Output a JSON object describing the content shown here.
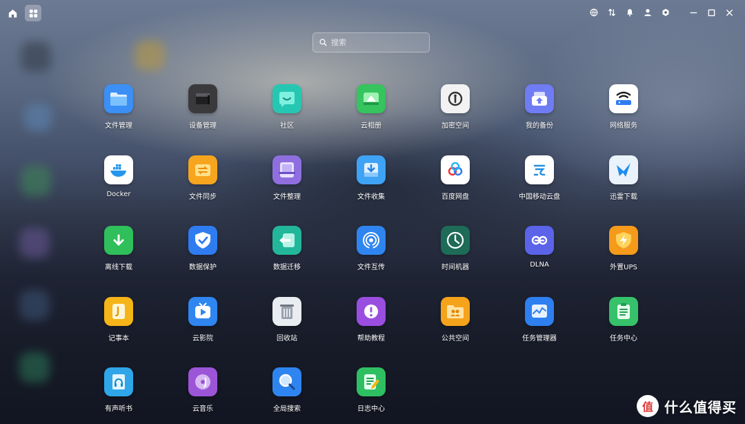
{
  "topbar": {
    "left": [
      {
        "name": "home",
        "icon": "home-icon",
        "active": false
      },
      {
        "name": "apps",
        "icon": "grid-icon",
        "active": true
      }
    ],
    "right": [
      {
        "name": "globe",
        "icon": "globe-icon"
      },
      {
        "name": "transfer",
        "icon": "transfer-icon"
      },
      {
        "name": "notification",
        "icon": "bell-icon"
      },
      {
        "name": "user",
        "icon": "user-icon"
      },
      {
        "name": "settings",
        "icon": "hexagon-settings-icon"
      },
      {
        "name": "minimize",
        "icon": "minimize-icon"
      },
      {
        "name": "maximize",
        "icon": "maximize-icon"
      },
      {
        "name": "close",
        "icon": "close-icon"
      }
    ]
  },
  "search": {
    "placeholder": "搜索"
  },
  "apps": [
    {
      "label": "文件管理",
      "icon": "folder-icon",
      "color": "#3b8ff5"
    },
    {
      "label": "设备管理",
      "icon": "device-box-icon",
      "color": "#3a3a3d"
    },
    {
      "label": "社区",
      "icon": "community-bubble-icon",
      "color": "#26c7b2"
    },
    {
      "label": "云相册",
      "icon": "photo-album-icon",
      "color": "#35c45e"
    },
    {
      "label": "加密空间",
      "icon": "safe-lock-icon",
      "color": "#f2f2f2"
    },
    {
      "label": "我的备份",
      "icon": "backup-upload-icon",
      "color": "#6f7cf3"
    },
    {
      "label": "网络服务",
      "icon": "wifi-router-icon",
      "color": "#ffffff"
    },
    {
      "label": "Docker",
      "icon": "docker-whale-icon",
      "color": "#ffffff"
    },
    {
      "label": "文件同步",
      "icon": "sync-folder-icon",
      "color": "#f7a51e"
    },
    {
      "label": "文件整理",
      "icon": "organize-drawer-icon",
      "color": "#8f6fe0"
    },
    {
      "label": "文件收集",
      "icon": "collect-download-icon",
      "color": "#3fa3f5"
    },
    {
      "label": "百度网盘",
      "icon": "baidu-pan-icon",
      "color": "#ffffff"
    },
    {
      "label": "中国移动云盘",
      "icon": "china-mobile-cloud-icon",
      "color": "#ffffff"
    },
    {
      "label": "迅雷下载",
      "icon": "thunder-bird-icon",
      "color": "#eaf3fc"
    },
    {
      "label": "离线下载",
      "icon": "offline-download-icon",
      "color": "#2fbf5b"
    },
    {
      "label": "数据保护",
      "icon": "shield-check-icon",
      "color": "#2f7cf0"
    },
    {
      "label": "数据迁移",
      "icon": "migrate-arrow-icon",
      "color": "#22b79a"
    },
    {
      "label": "文件互传",
      "icon": "airdrop-icon",
      "color": "#2f85f0"
    },
    {
      "label": "时间机器",
      "icon": "time-machine-icon",
      "color": "#1e6b57"
    },
    {
      "label": "DLNA",
      "icon": "dlna-icon",
      "color": "#5b63e8"
    },
    {
      "label": "外置UPS",
      "icon": "ups-lightning-icon",
      "color": "#f59a1b"
    },
    {
      "label": "记事本",
      "icon": "notepad-icon",
      "color": "#f5b418"
    },
    {
      "label": "云影院",
      "icon": "tv-play-icon",
      "color": "#2f86f0"
    },
    {
      "label": "回收站",
      "icon": "trash-bin-icon",
      "color": "#e9ecf0"
    },
    {
      "label": "帮助教程",
      "icon": "help-exclaim-icon",
      "color": "#9a4ee0"
    },
    {
      "label": "公共空间",
      "icon": "public-folder-icon",
      "color": "#f5a31b"
    },
    {
      "label": "任务管理器",
      "icon": "task-monitor-icon",
      "color": "#2e7ff0"
    },
    {
      "label": "任务中心",
      "icon": "task-clipboard-icon",
      "color": "#36c26a"
    },
    {
      "label": "有声听书",
      "icon": "audiobook-icon",
      "color": "#2fa6e8"
    },
    {
      "label": "云音乐",
      "icon": "music-disc-icon",
      "color": "#9c55d6"
    },
    {
      "label": "全局搜索",
      "icon": "global-search-icon",
      "color": "#2f85f0"
    },
    {
      "label": "日志中心",
      "icon": "log-pencil-icon",
      "color": "#2fbf63"
    }
  ],
  "watermark": {
    "text": "什么值得买",
    "logo_text": "值"
  }
}
